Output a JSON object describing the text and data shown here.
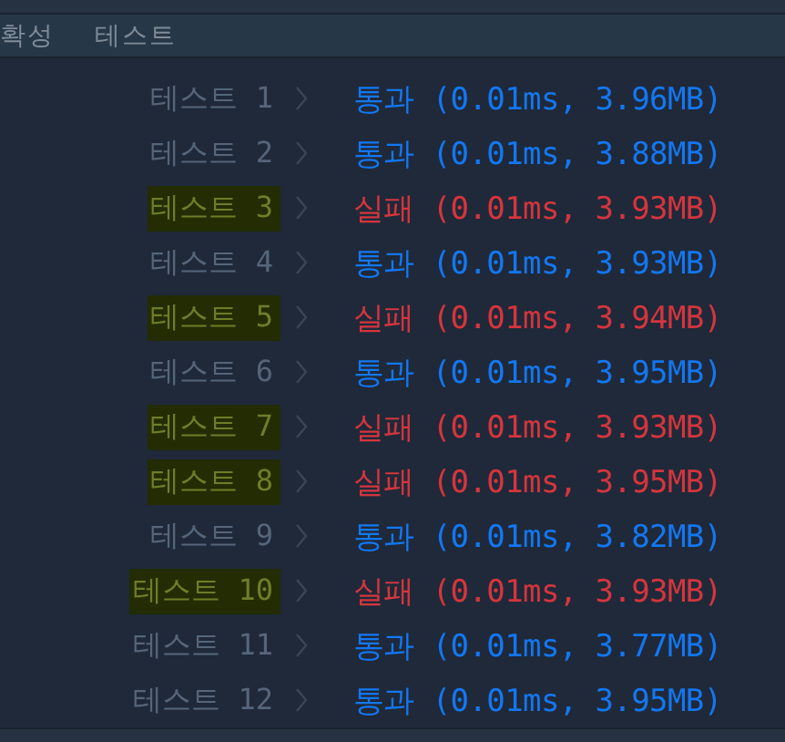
{
  "header": {
    "tabs": [
      {
        "label": "확성"
      },
      {
        "label": "테스트"
      }
    ]
  },
  "tests": [
    {
      "label": "테스트 1",
      "result": "통과 (0.01ms, 3.96MB)",
      "kind": "pass",
      "highlighted": false
    },
    {
      "label": "테스트 2",
      "result": "통과 (0.01ms, 3.88MB)",
      "kind": "pass",
      "highlighted": false
    },
    {
      "label": "테스트 3",
      "result": "실패 (0.01ms, 3.93MB)",
      "kind": "fail",
      "highlighted": true
    },
    {
      "label": "테스트 4",
      "result": "통과 (0.01ms, 3.93MB)",
      "kind": "pass",
      "highlighted": false
    },
    {
      "label": "테스트 5",
      "result": "실패 (0.01ms, 3.94MB)",
      "kind": "fail",
      "highlighted": true
    },
    {
      "label": "테스트 6",
      "result": "통과 (0.01ms, 3.95MB)",
      "kind": "pass",
      "highlighted": false
    },
    {
      "label": "테스트 7",
      "result": "실패 (0.01ms, 3.93MB)",
      "kind": "fail",
      "highlighted": true
    },
    {
      "label": "테스트 8",
      "result": "실패 (0.01ms, 3.95MB)",
      "kind": "fail",
      "highlighted": true
    },
    {
      "label": "테스트 9",
      "result": "통과 (0.01ms, 3.82MB)",
      "kind": "pass",
      "highlighted": false
    },
    {
      "label": "테스트 10",
      "result": "실패 (0.01ms, 3.93MB)",
      "kind": "fail",
      "highlighted": true
    },
    {
      "label": "테스트 11",
      "result": "통과 (0.01ms, 3.77MB)",
      "kind": "pass",
      "highlighted": false
    },
    {
      "label": "테스트 12",
      "result": "통과 (0.01ms, 3.95MB)",
      "kind": "pass",
      "highlighted": false
    }
  ]
}
